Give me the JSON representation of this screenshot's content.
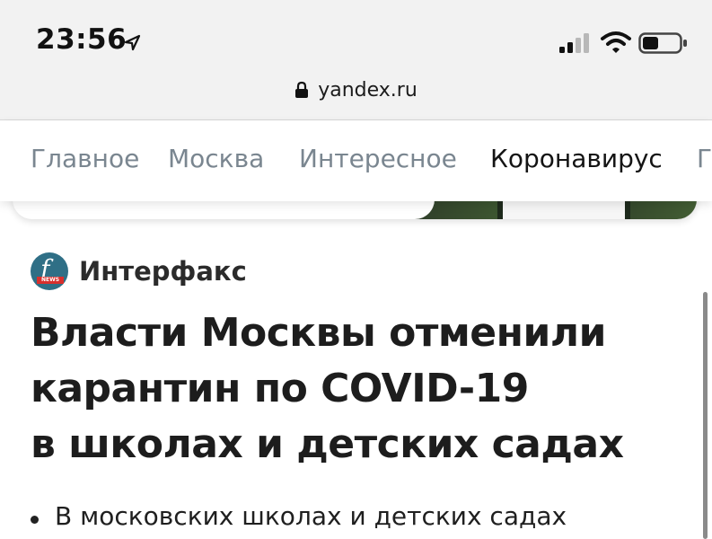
{
  "status_bar": {
    "time": "23:56",
    "icons": [
      "location-arrow-icon",
      "signal-icon",
      "wifi-icon",
      "battery-icon"
    ]
  },
  "browser": {
    "url": "yandex.ru",
    "secure_icon": "lock-icon"
  },
  "tabs": [
    {
      "label": "Главное",
      "active": false
    },
    {
      "label": "Москва",
      "active": false
    },
    {
      "label": "Интересное",
      "active": false
    },
    {
      "label": "Коронавирус",
      "active": true
    },
    {
      "label": "Г",
      "active": false
    }
  ],
  "article": {
    "source": "Интерфакс",
    "source_logo": {
      "letter": "f",
      "badge": "NEWS"
    },
    "headline_lines": [
      "Власти Москвы отменили",
      "карантин по COVID-19",
      "в школах и детских садах"
    ],
    "bullets": [
      "В московских школах и детских садах"
    ]
  },
  "colors": {
    "tab_inactive": "#7a8690",
    "tab_active": "#141414",
    "topbar_bg": "#f2f2f2",
    "logo_bg": "#2f6f86",
    "logo_badge": "#d8302d"
  }
}
